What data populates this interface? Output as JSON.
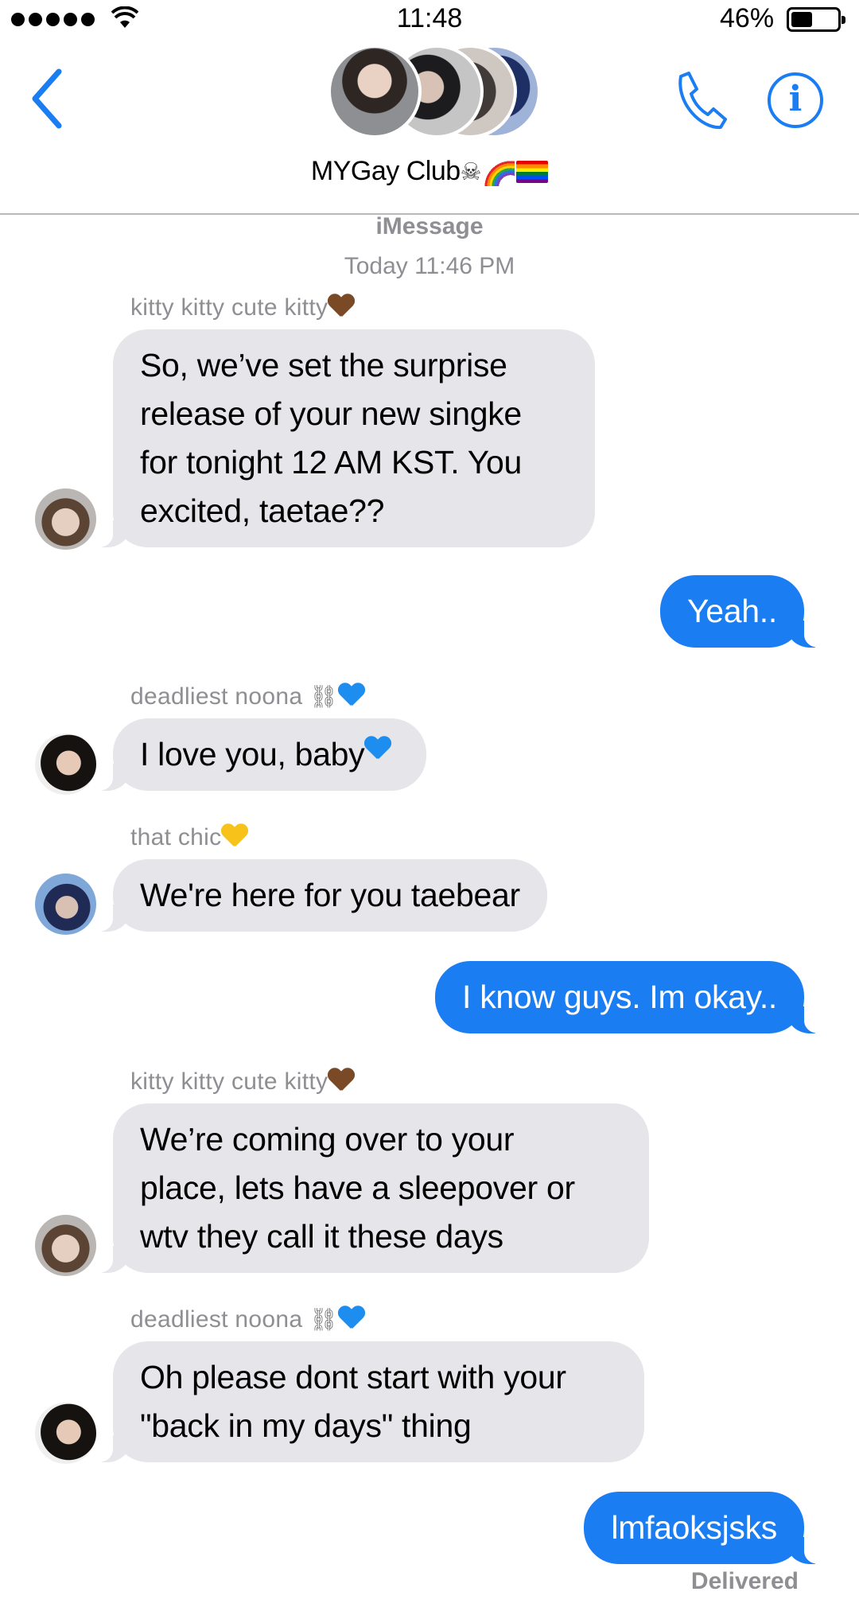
{
  "status_bar": {
    "time": "11:48",
    "battery_percent": "46%",
    "battery_level": 0.46,
    "signal_bars": 5
  },
  "header": {
    "back_icon": "chevron-left-icon",
    "call_icon": "phone-icon",
    "info_icon": "info-icon",
    "info_glyph": "i",
    "group_name": "MYGay Club",
    "group_emojis": [
      "skull",
      "rainbow",
      "rainbow-flag"
    ],
    "accent_color": "#1a7df2"
  },
  "conversation": {
    "service_label": "iMessage",
    "timestamp": "Today 11:46 PM",
    "delivered_label": "Delivered"
  },
  "messages": [
    {
      "direction": "incoming",
      "sender": "kitty kitty cute kitty",
      "sender_emoji": "brown-heart",
      "avatar": "kitty",
      "text": "So, we’ve set the surprise\nrelease of your new singke\nfor tonight 12 AM KST. You\nexcited, taetae??"
    },
    {
      "direction": "outgoing",
      "text": "Yeah.."
    },
    {
      "direction": "incoming",
      "sender": "deadliest noona",
      "sender_emoji": "chains-blue-heart",
      "avatar": "noona",
      "text": "I love you, baby"
    },
    {
      "direction": "incoming",
      "sender": "that chic",
      "sender_emoji": "yellow-heart",
      "avatar": "chic",
      "text": "We're here for you taebear"
    },
    {
      "direction": "outgoing",
      "text": "I know guys. Im okay.."
    },
    {
      "direction": "incoming",
      "sender": "kitty kitty cute kitty",
      "sender_emoji": "brown-heart",
      "avatar": "kitty",
      "text": "We’re coming over to your\nplace, lets have a sleepover or\nwtv they call it these days"
    },
    {
      "direction": "incoming",
      "sender": "deadliest noona",
      "sender_emoji": "chains-blue-heart",
      "avatar": "noona",
      "text": "Oh please dont start with your\n\"back in my days\" thing"
    },
    {
      "direction": "outgoing",
      "text": "lmfaoksjsks"
    }
  ],
  "colors": {
    "incoming_bubble": "#e5e5ea",
    "outgoing_bubble": "#1a7df2",
    "meta_text": "#8e8e93"
  }
}
